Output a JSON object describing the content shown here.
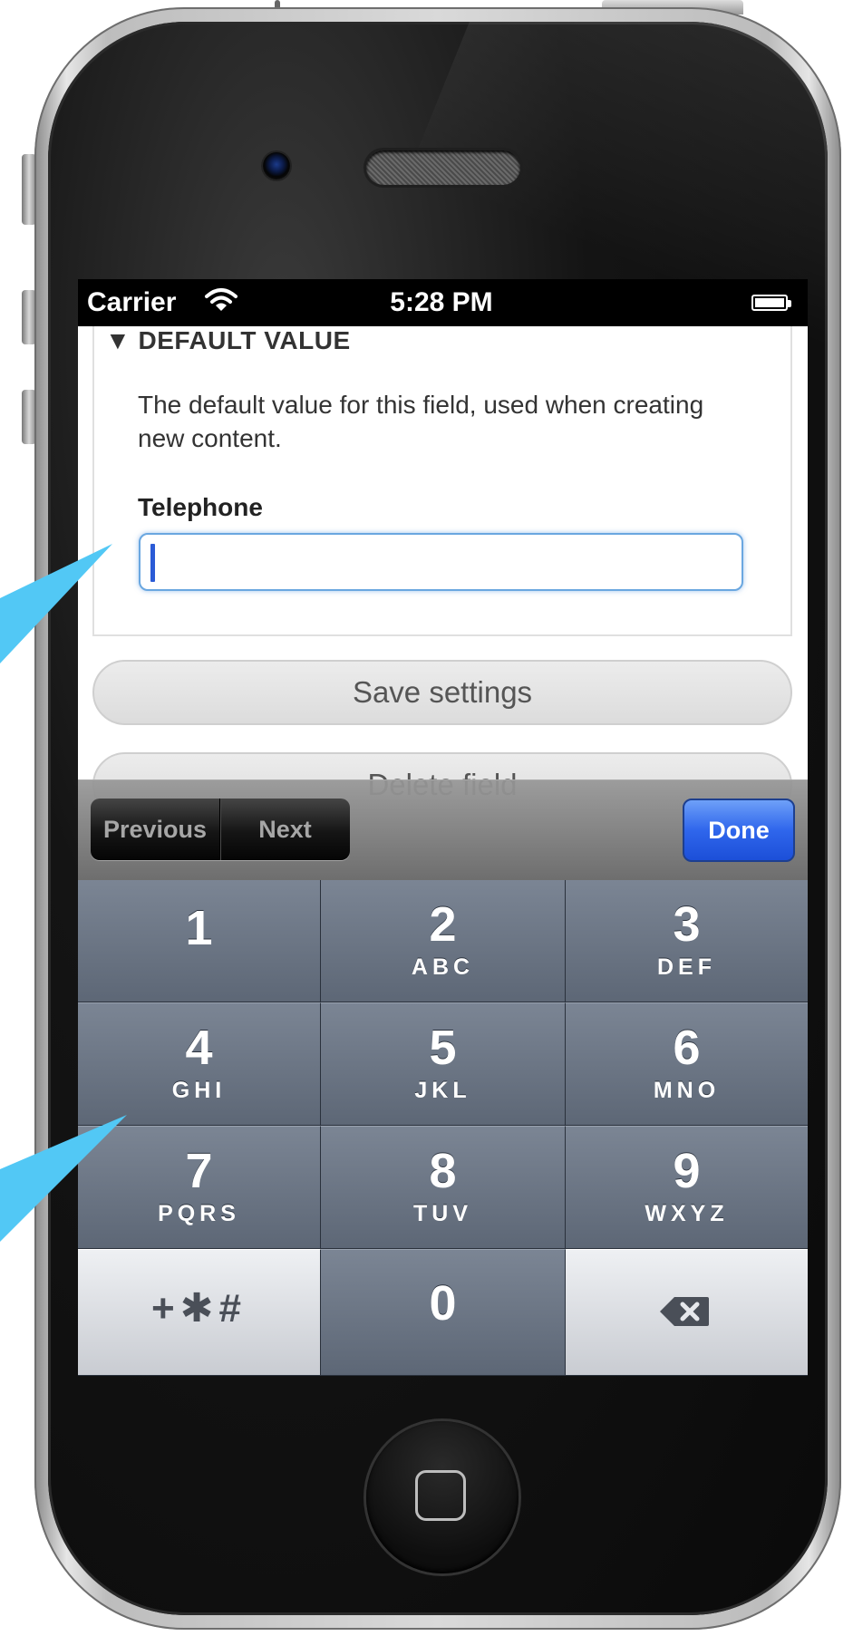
{
  "status_bar": {
    "carrier": "Carrier",
    "time": "5:28 PM"
  },
  "form": {
    "section_title": "▼ DEFAULT VALUE",
    "description": "The default value for this field, used when creating new content.",
    "field_label": "Telephone",
    "field_value": ""
  },
  "buttons": {
    "save": "Save settings",
    "delete": "Delete field"
  },
  "accessory_toolbar": {
    "previous": "Previous",
    "next": "Next",
    "done": "Done"
  },
  "keypad": {
    "keys": [
      {
        "digit": "1",
        "letters": ""
      },
      {
        "digit": "2",
        "letters": "ABC"
      },
      {
        "digit": "3",
        "letters": "DEF"
      },
      {
        "digit": "4",
        "letters": "GHI"
      },
      {
        "digit": "5",
        "letters": "JKL"
      },
      {
        "digit": "6",
        "letters": "MNO"
      },
      {
        "digit": "7",
        "letters": "PQRS"
      },
      {
        "digit": "8",
        "letters": "TUV"
      },
      {
        "digit": "9",
        "letters": "WXYZ"
      },
      {
        "digit": "0",
        "letters": ""
      }
    ],
    "symbols_key": "+✱#",
    "backspace_icon": "backspace-icon"
  },
  "colors": {
    "callout_arrow": "#52c8f5",
    "done_button": "#2f66ec",
    "input_focus": "#6aa7e0"
  }
}
